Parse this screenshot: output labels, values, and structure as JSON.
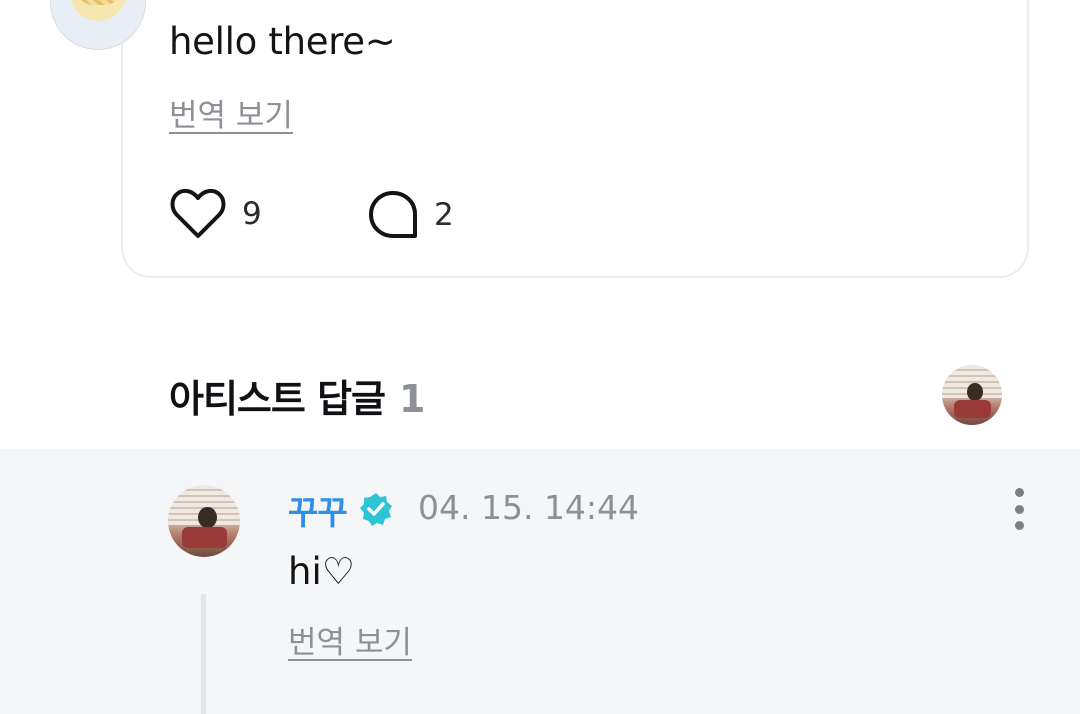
{
  "post": {
    "text": "hello there~",
    "translate_label": "번역 보기",
    "likes": "9",
    "comments": "2"
  },
  "artist_replies": {
    "title": "아티스트 답글",
    "count": "1"
  },
  "reply": {
    "author": "꾸꾸",
    "timestamp": "04. 15. 14:44",
    "text": "hi♡",
    "translate_label": "번역 보기"
  },
  "colors": {
    "author_blue": "#2f8fe9",
    "verified_teal": "#2ec4d6",
    "muted_gray": "#8d9096",
    "reply_bg": "#f5f6f8"
  },
  "icons": [
    "heart-icon",
    "comment-bubble-icon",
    "verified-badge-icon",
    "more-vertical-icon"
  ]
}
